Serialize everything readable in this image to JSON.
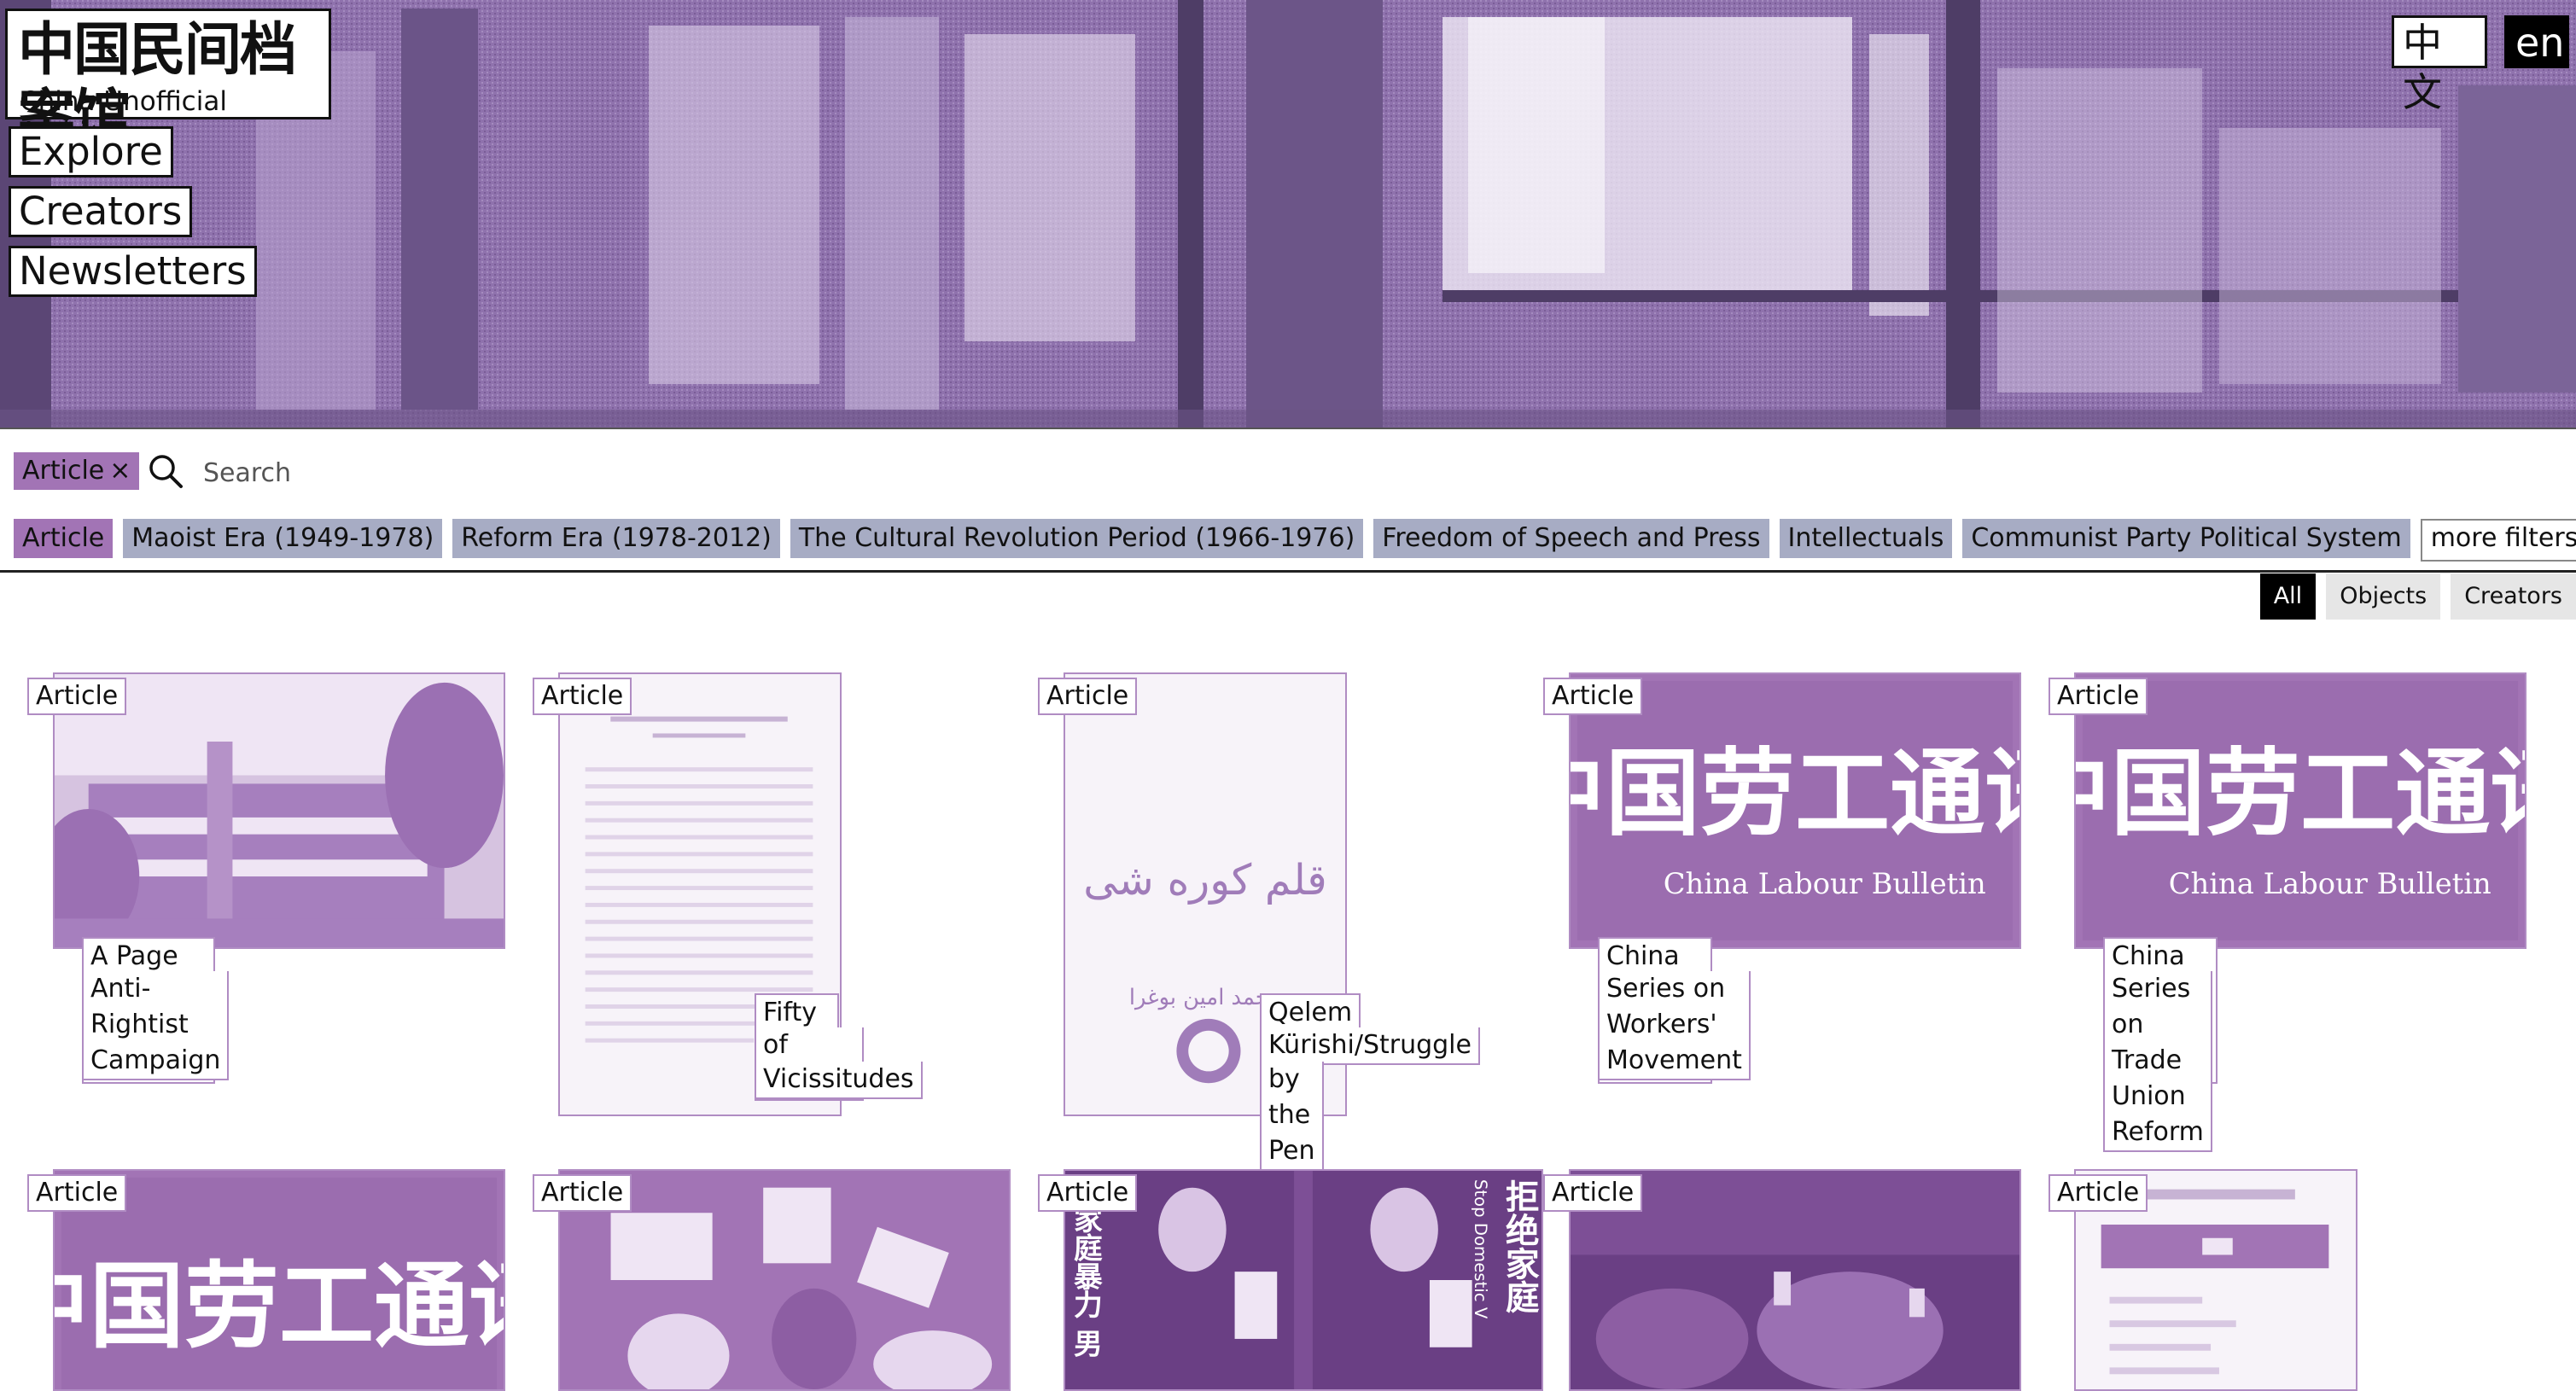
{
  "site": {
    "logo_zh": "中国民间档案馆",
    "logo_en": "China Unofficial Archives"
  },
  "nav": [
    "Explore",
    "Creators",
    "Newsletters"
  ],
  "languages": {
    "zh": "中文",
    "en": "en",
    "selected": "en"
  },
  "search": {
    "active_filter": "Article",
    "remove_symbol": "×",
    "placeholder": "Search",
    "icon": "search-icon"
  },
  "filters": [
    "Article",
    "Maoist Era (1949-1978)",
    "Reform Era (1978-2012)",
    "The Cultural Revolution Period (1966-1976)",
    "Freedom of Speech and Press",
    "Intellectuals",
    "Communist Party Political System"
  ],
  "more_filters": "more filters",
  "view_tabs": {
    "all": "All",
    "objects": "Objects",
    "creators": "Creators",
    "selected": "All"
  },
  "cards": [
    {
      "type": "Article",
      "title_lines": [
        "A Page Vanished in the CAS",
        "Anti-Rightist Campaign"
      ]
    },
    {
      "type": "Article",
      "title_lines": [
        "Fifty Years",
        "of Stormy",
        "Vicissitudes"
      ]
    },
    {
      "type": "Article",
      "title_lines": [
        "Qelem",
        "Kürishi/Struggle",
        "by the Pen"
      ],
      "thumb_text": "قلم كوره شى",
      "thumb_subtext": "محمد امين بوغرا"
    },
    {
      "type": "Article",
      "title_lines": [
        "China Labour Bulletin Report",
        "Series on Workers' Movement"
      ],
      "thumb_zh": "中国劳工通讯",
      "thumb_en": "China Labour Bulletin"
    },
    {
      "type": "Article",
      "title_lines": [
        "China Labour Bulletin Report",
        "Series on Trade Union Reform"
      ],
      "thumb_zh": "中国劳工通讯",
      "thumb_en": "China Labour Bulletin"
    },
    {
      "type": "Article",
      "thumb_zh": "中国劳工通讯"
    },
    {
      "type": "Article"
    },
    {
      "type": "Article",
      "thumb_zh_left": "家庭暴力 男",
      "thumb_zh_right": "拒绝家庭",
      "thumb_en_vertical": "Stop Domestic V"
    },
    {
      "type": "Article"
    },
    {
      "type": "Article"
    }
  ],
  "colors": {
    "brand_purple": "#8f72ad",
    "chip_active": "#a274b5",
    "chip": "#a7acc4",
    "card_border": "#b08cc3"
  }
}
